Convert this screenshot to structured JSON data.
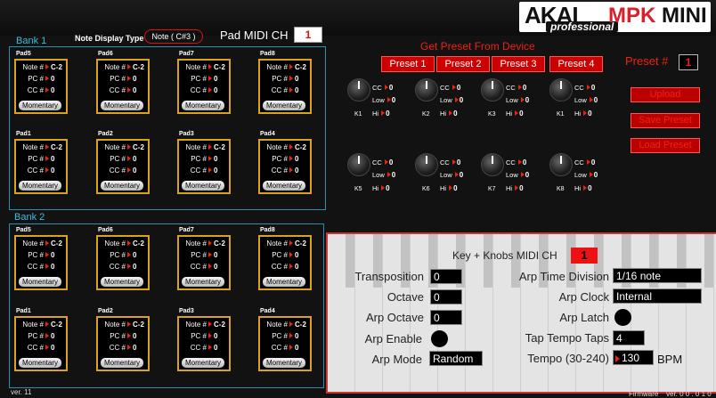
{
  "header": {
    "logo": {
      "akai": "AKAI",
      "professional": "professional",
      "mpk": "MPK",
      "mini": "MINI"
    },
    "note_display_label": "Note Display Type",
    "note_display_value": "Note ( C#3 )",
    "pad_midi_label": "Pad MIDI CH",
    "pad_midi_value": "1"
  },
  "bank1": {
    "label": "Bank 1",
    "pads": [
      {
        "name": "Pad5",
        "note": "C-2",
        "pc": "0",
        "cc": "0",
        "mode": "Momentary"
      },
      {
        "name": "Pad6",
        "note": "C-2",
        "pc": "0",
        "cc": "0",
        "mode": "Momentary"
      },
      {
        "name": "Pad7",
        "note": "C-2",
        "pc": "0",
        "cc": "0",
        "mode": "Momentary"
      },
      {
        "name": "Pad8",
        "note": "C-2",
        "pc": "0",
        "cc": "0",
        "mode": "Momentary"
      },
      {
        "name": "Pad1",
        "note": "C-2",
        "pc": "0",
        "cc": "0",
        "mode": "Momentary"
      },
      {
        "name": "Pad2",
        "note": "C-2",
        "pc": "0",
        "cc": "0",
        "mode": "Momentary"
      },
      {
        "name": "Pad3",
        "note": "C-2",
        "pc": "0",
        "cc": "0",
        "mode": "Momentary"
      },
      {
        "name": "Pad4",
        "note": "C-2",
        "pc": "0",
        "cc": "0",
        "mode": "Momentary"
      }
    ]
  },
  "bank2": {
    "label": "Bank 2",
    "pads": [
      {
        "name": "Pad5",
        "note": "C-2",
        "pc": "0",
        "cc": "0",
        "mode": "Momentary"
      },
      {
        "name": "Pad6",
        "note": "C-2",
        "pc": "0",
        "cc": "0",
        "mode": "Momentary"
      },
      {
        "name": "Pad7",
        "note": "C-2",
        "pc": "0",
        "cc": "0",
        "mode": "Momentary"
      },
      {
        "name": "Pad8",
        "note": "C-2",
        "pc": "0",
        "cc": "0",
        "mode": "Momentary"
      },
      {
        "name": "Pad1",
        "note": "C-2",
        "pc": "0",
        "cc": "0",
        "mode": "Momentary"
      },
      {
        "name": "Pad2",
        "note": "C-2",
        "pc": "0",
        "cc": "0",
        "mode": "Momentary"
      },
      {
        "name": "Pad3",
        "note": "C-2",
        "pc": "0",
        "cc": "0",
        "mode": "Momentary"
      },
      {
        "name": "Pad4",
        "note": "C-2",
        "pc": "0",
        "cc": "0",
        "mode": "Momentary"
      }
    ]
  },
  "pad_labels": {
    "note": "Note #",
    "pc": "PC #",
    "cc": "CC #"
  },
  "preset": {
    "get_title": "Get Preset From Device",
    "buttons": [
      "Preset 1",
      "Preset 2",
      "Preset 3",
      "Preset 4"
    ],
    "number_label": "Preset #",
    "number_value": "1",
    "upload": "Upload",
    "save": "Save Preset",
    "load": "Load Preset"
  },
  "knob_field_labels": {
    "cc": "CC",
    "low": "Low",
    "hi": "Hi"
  },
  "knobs": [
    {
      "name": "K1",
      "cc": "0",
      "low": "0",
      "hi": "0"
    },
    {
      "name": "K2",
      "cc": "0",
      "low": "0",
      "hi": "0"
    },
    {
      "name": "K3",
      "cc": "0",
      "low": "0",
      "hi": "0"
    },
    {
      "name": "K1",
      "cc": "0",
      "low": "0",
      "hi": "0"
    },
    {
      "name": "K5",
      "cc": "0",
      "low": "0",
      "hi": "0"
    },
    {
      "name": "K6",
      "cc": "0",
      "low": "0",
      "hi": "0"
    },
    {
      "name": "K7",
      "cc": "0",
      "low": "0",
      "hi": "0"
    },
    {
      "name": "K8",
      "cc": "0",
      "low": "0",
      "hi": "0"
    }
  ],
  "settings": {
    "keys_midi_label": "Key + Knobs MIDI CH",
    "keys_midi_value": "1",
    "transposition_label": "Transposition",
    "transposition_value": "0",
    "octave_label": "Octave",
    "octave_value": "0",
    "arp_octave_label": "Arp Octave",
    "arp_octave_value": "0",
    "arp_enable_label": "Arp Enable",
    "arp_mode_label": "Arp Mode",
    "arp_mode_value": "Random",
    "arp_time_div_label": "Arp Time Division",
    "arp_time_div_value": "1/16 note",
    "arp_clock_label": "Arp Clock",
    "arp_clock_value": "Internal",
    "arp_latch_label": "Arp Latch",
    "tap_tempo_label": "Tap Tempo Taps",
    "tap_tempo_value": "4",
    "tempo_label": "Tempo (30-240)",
    "tempo_value": "130",
    "tempo_unit": "BPM"
  },
  "footer": {
    "version_left": "ver. 11",
    "firmware_label": "Firmware",
    "firmware_version": "ver. 0 0 . 0 1 0"
  }
}
